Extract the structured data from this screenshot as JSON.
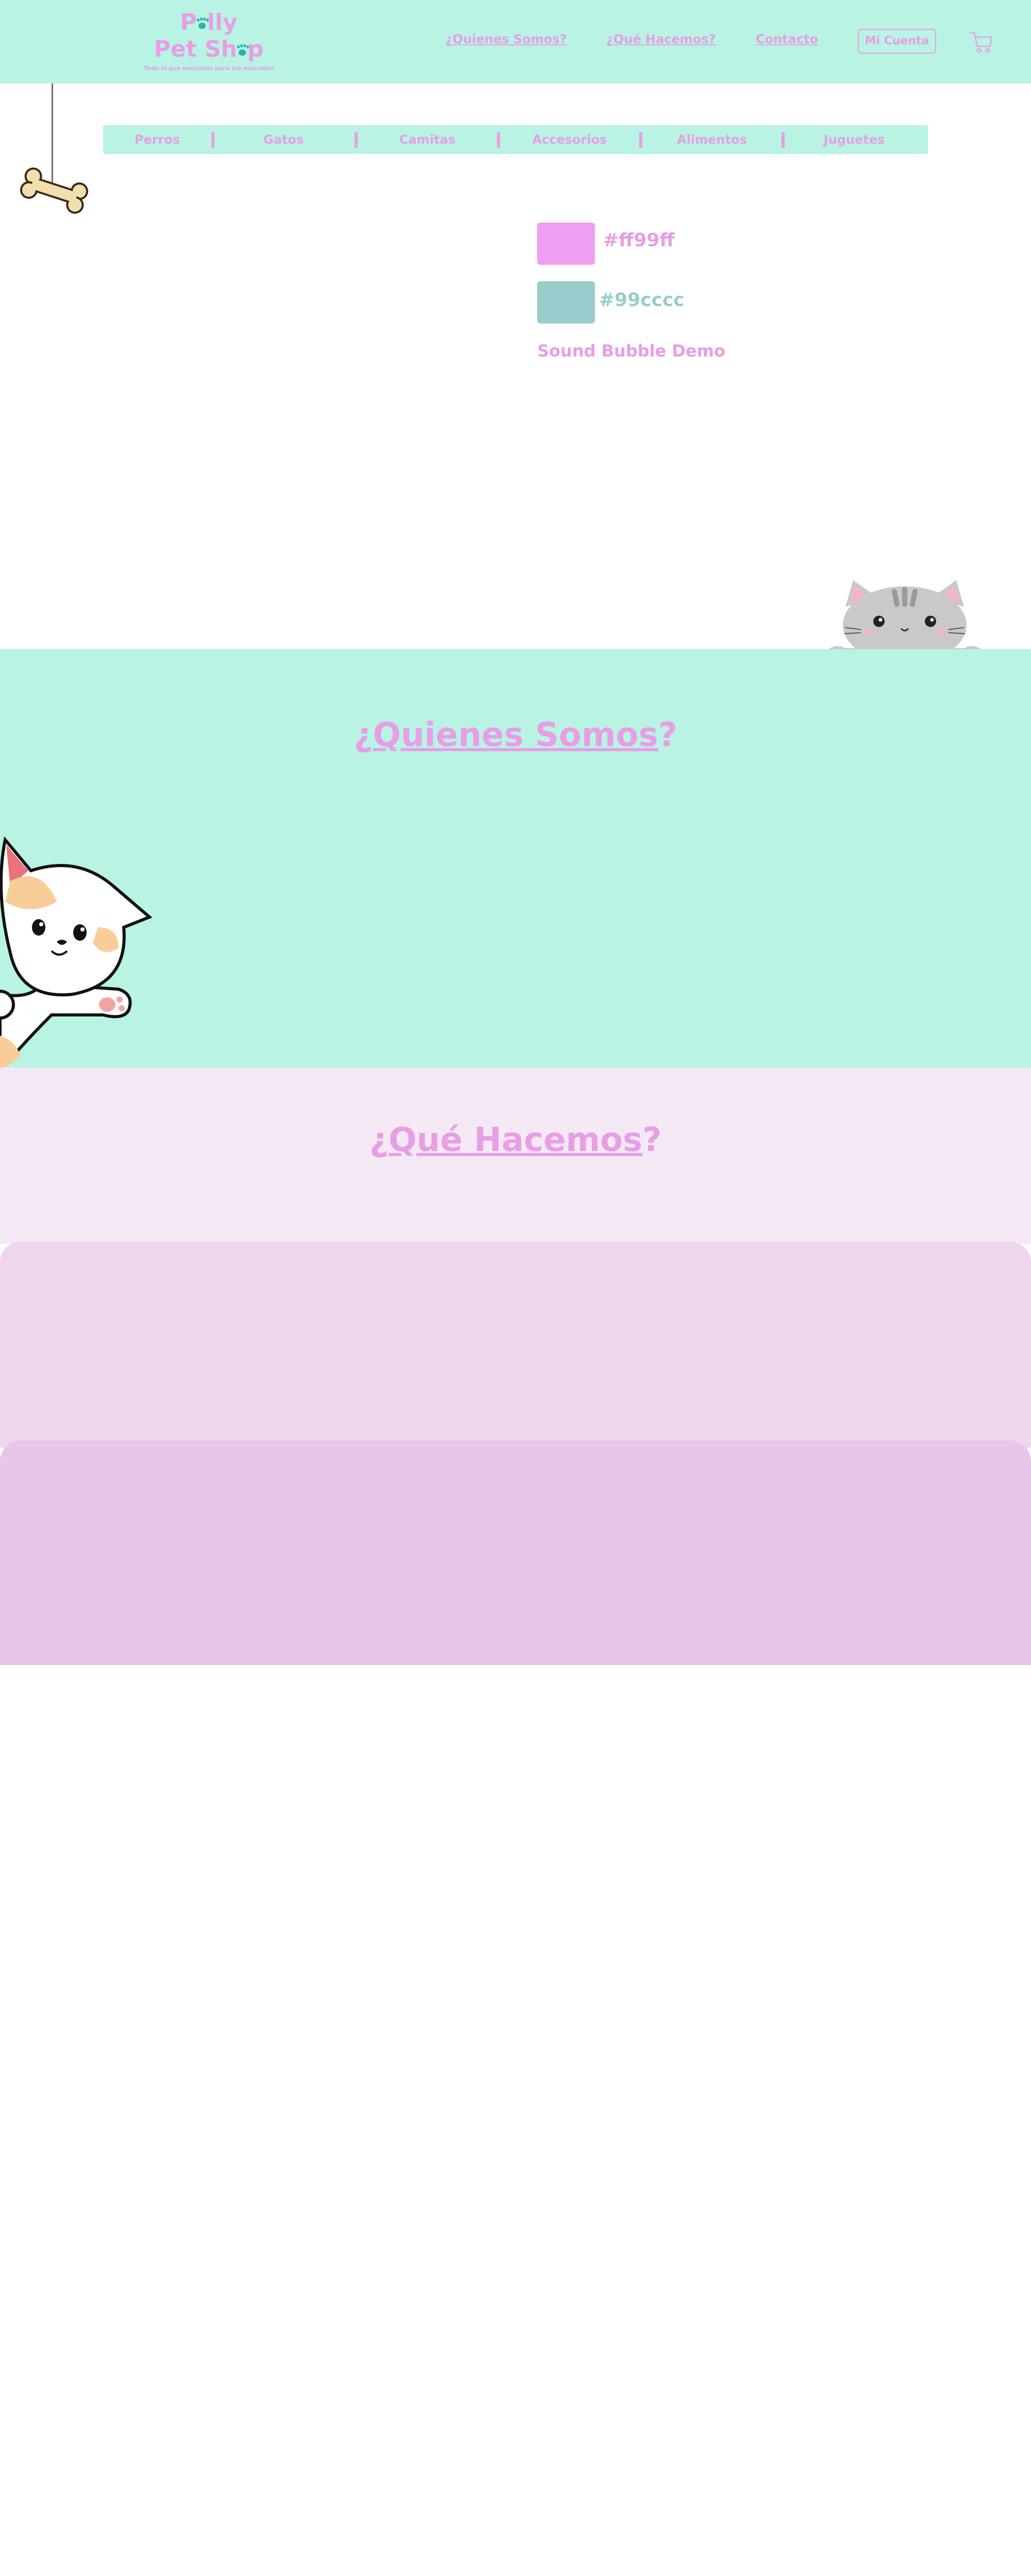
{
  "header": {
    "logo": {
      "line1_a": "P",
      "line1_b": "lly",
      "line2_a": "Pet Sh",
      "line2_b": "p",
      "tagline": "Todo lo que necesitas para tus mascotas"
    },
    "nav": {
      "quienes": "¿Quienes Somos?",
      "hacemos": "¿Qué Hacemos?",
      "contacto": "Contacto"
    },
    "account_label": "Mi Cuenta",
    "cart_icon": "cart-icon"
  },
  "categories": [
    "Perros",
    "Gatos",
    "Camitas",
    "Accesorios",
    "Alimentos",
    "Juguetes"
  ],
  "colors": {
    "pink": "#ff99ff",
    "teal": "#99cccc",
    "mint": "#b8f3e4"
  },
  "swatches": {
    "pink_label": "#ff99ff",
    "teal_label_a": "#",
    "teal_label_b": "99cccc"
  },
  "sound_demo": "Sound Bubble Demo",
  "about": {
    "title_a": "¿",
    "title_b": "Quienes Somos",
    "title_c": "?"
  },
  "what": {
    "title_a": "¿",
    "title_b": "Qué Hacemos",
    "title_c": "?"
  }
}
